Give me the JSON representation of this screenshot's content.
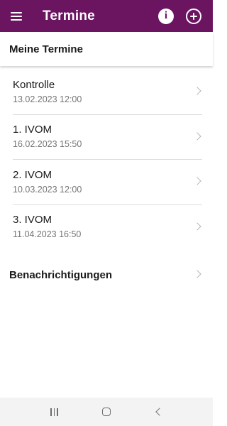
{
  "appbar": {
    "title": "Termine",
    "menu_icon": "hamburger-menu-icon",
    "info_icon": "info-icon",
    "info_glyph": "i",
    "add_icon": "add-circle-icon",
    "background": "#6b1460"
  },
  "section": {
    "title": "Meine Termine"
  },
  "appointments": [
    {
      "title": "Kontrolle",
      "date": "13.02.2023 12:00"
    },
    {
      "title": "1. IVOM",
      "date": "16.02.2023 15:50"
    },
    {
      "title": "2. IVOM",
      "date": "10.03.2023 12:00"
    },
    {
      "title": "3. IVOM",
      "date": "11.04.2023 16:50"
    }
  ],
  "notifications": {
    "label": "Benachrichtigungen"
  },
  "system_nav": {
    "recents_icon": "recents-icon",
    "home_icon": "home-icon",
    "back_icon": "back-icon"
  }
}
